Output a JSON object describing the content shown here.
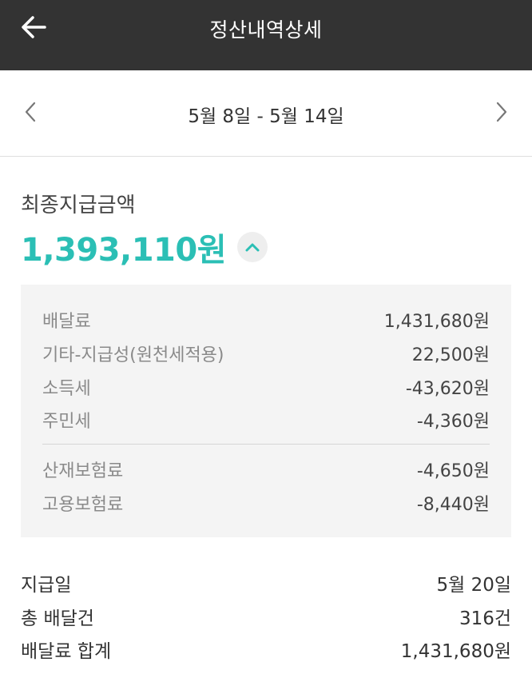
{
  "header": {
    "title": "정산내역상세",
    "back_icon": "arrow-left-icon"
  },
  "period": {
    "label": "5월 8일 - 5월 14일",
    "prev_icon": "chevron-left-icon",
    "next_icon": "chevron-right-icon"
  },
  "final_payment": {
    "label": "최종지급금액",
    "amount": "1,393,110원",
    "accent_color": "#2bbfb5",
    "toggle_icon": "chevron-up-icon",
    "expanded": true
  },
  "breakdown": {
    "rows": [
      {
        "label": "배달료",
        "value": "1,431,680원"
      },
      {
        "label": "기타-지급성(원천세적용)",
        "value": "22,500원"
      },
      {
        "label": "소득세",
        "value": "-43,620원"
      },
      {
        "label": "주민세",
        "value": "-4,360원"
      }
    ],
    "insurance_rows": [
      {
        "label": "산재보험료",
        "value": "-4,650원"
      },
      {
        "label": "고용보험료",
        "value": "-8,440원"
      }
    ]
  },
  "summary": {
    "rows": [
      {
        "label": "지급일",
        "value": "5월 20일"
      },
      {
        "label": "총 배달건",
        "value": "316건"
      },
      {
        "label": "배달료 합계",
        "value": "1,431,680원"
      }
    ]
  }
}
